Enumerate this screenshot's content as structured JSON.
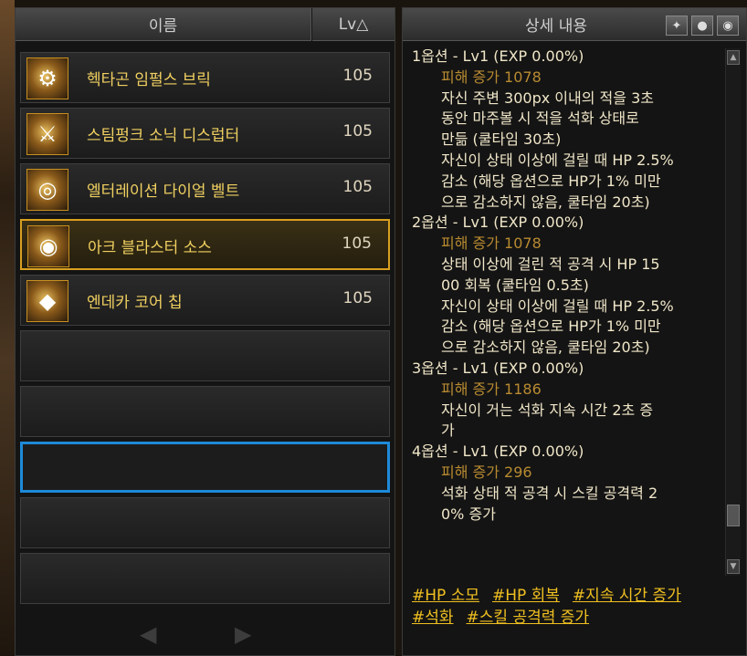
{
  "left_panel": {
    "header_name": "이름",
    "header_lv": "Lv△",
    "items": [
      {
        "name": "헥타곤 임펄스 브릭",
        "level": "105"
      },
      {
        "name": "스팀펑크 소닉 디스럽터",
        "level": "105"
      },
      {
        "name": "엘터레이션 다이얼 벨트",
        "level": "105"
      },
      {
        "name": "아크 블라스터 소스",
        "level": "105"
      },
      {
        "name": "엔데카 코어 칩",
        "level": "105"
      }
    ],
    "prev_arrow": "◀",
    "next_arrow": "▶"
  },
  "right_panel": {
    "header": "상세 내용",
    "header_icons": [
      "wolf-icon",
      "pin-icon",
      "eye-icon"
    ],
    "lines": [
      {
        "t": "title",
        "text": "1옵션 - Lv1 (EXP 0.00%)"
      },
      {
        "t": "dmg",
        "text": "피해 증가 1078"
      },
      {
        "t": "desc",
        "text": "자신 주변 300px 이내의 적을 3초"
      },
      {
        "t": "desc",
        "text": "동안 마주볼 시 적을 석화 상태로"
      },
      {
        "t": "desc",
        "text": "만듦 (쿨타임 30초)"
      },
      {
        "t": "desc",
        "text": "자신이 상태 이상에 걸릴 때 HP 2.5%"
      },
      {
        "t": "desc",
        "text": "감소 (해당 옵션으로 HP가 1% 미만"
      },
      {
        "t": "desc",
        "text": "으로 감소하지 않음, 쿨타임 20초)"
      },
      {
        "t": "title",
        "text": "2옵션 - Lv1 (EXP 0.00%)"
      },
      {
        "t": "dmg",
        "text": "피해 증가 1078"
      },
      {
        "t": "desc",
        "text": "상태 이상에 걸린 적 공격 시 HP 15"
      },
      {
        "t": "desc",
        "text": "00 회복 (쿨타임 0.5초)"
      },
      {
        "t": "desc",
        "text": "자신이 상태 이상에 걸릴 때 HP 2.5%"
      },
      {
        "t": "desc",
        "text": "감소 (해당 옵션으로 HP가 1% 미만"
      },
      {
        "t": "desc",
        "text": "으로 감소하지 않음, 쿨타임 20초)"
      },
      {
        "t": "title",
        "text": "3옵션 - Lv1 (EXP 0.00%)"
      },
      {
        "t": "dmg",
        "text": "피해 증가 1186"
      },
      {
        "t": "desc",
        "text": "자신이 거는 석화 지속 시간 2초 증"
      },
      {
        "t": "desc",
        "text": "가"
      },
      {
        "t": "title",
        "text": "4옵션 - Lv1 (EXP 0.00%)"
      },
      {
        "t": "dmg",
        "text": "피해 증가 296"
      },
      {
        "t": "desc",
        "text": "석화 상태 적 공격 시 스킬 공격력 2"
      },
      {
        "t": "desc",
        "text": "0% 증가"
      }
    ],
    "tags": [
      "#HP 소모",
      "#HP 회복",
      "#지속 시간 증가",
      "#석화",
      "#스킬 공격력 증가"
    ]
  },
  "colors": {
    "selected_border": "#d9a020",
    "focused_border": "#1e8ad8",
    "item_name": "#f0d060",
    "tag": "#f0c020"
  }
}
